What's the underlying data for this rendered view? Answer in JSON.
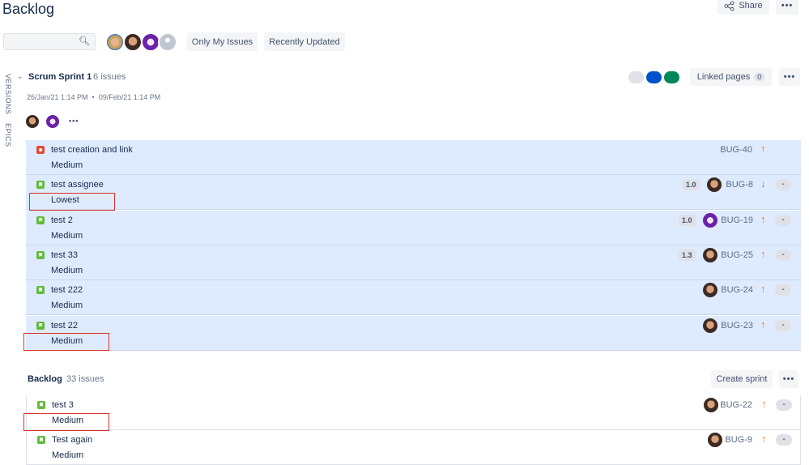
{
  "header": {
    "title": "Backlog",
    "share_label": "Share",
    "more_label": "•••"
  },
  "filters": {
    "search_placeholder": "",
    "only_my_issues": "Only My Issues",
    "recently_updated": "Recently Updated"
  },
  "side_tabs": {
    "versions": "VERSIONS",
    "epics": "EPICS"
  },
  "sprint": {
    "name": "Scrum Sprint 1",
    "count": "6 issues",
    "dates": "26/Jan/21 1:14 PM  •  09/Feb/21 1:14 PM",
    "linked_pages_label": "Linked pages",
    "linked_pages_count": "0",
    "more": "•••",
    "status_colors": [
      "#dfe1e6",
      "#0052cc",
      "#00875a"
    ],
    "issues": [
      {
        "type": "bug",
        "title": "test creation and link",
        "priority": "Medium",
        "key": "BUG-40",
        "estimate": "",
        "arrow": "up",
        "avatar": "",
        "status": ""
      },
      {
        "type": "story",
        "title": "test assignee",
        "priority": "Lowest",
        "key": "BUG-8",
        "estimate": "1.0",
        "arrow": "down",
        "avatar": "face",
        "status": "-"
      },
      {
        "type": "story",
        "title": "test 2",
        "priority": "Medium",
        "key": "BUG-19",
        "estimate": "1.0",
        "arrow": "up",
        "avatar": "ghost",
        "status": "-"
      },
      {
        "type": "story",
        "title": "test 33",
        "priority": "Medium",
        "key": "BUG-25",
        "estimate": "1.3",
        "arrow": "up",
        "avatar": "face",
        "status": "-"
      },
      {
        "type": "story",
        "title": "test 222",
        "priority": "Medium",
        "key": "BUG-24",
        "estimate": "",
        "arrow": "up",
        "avatar": "face",
        "status": "-"
      },
      {
        "type": "story",
        "title": "test 22",
        "priority": "Medium",
        "key": "BUG-23",
        "estimate": "",
        "arrow": "up",
        "avatar": "face",
        "status": "-"
      }
    ]
  },
  "backlog": {
    "name": "Backlog",
    "count": "33 issues",
    "create_sprint": "Create sprint",
    "more": "•••",
    "issues": [
      {
        "type": "story",
        "title": "test 3",
        "priority": "Medium",
        "key": "BUG-22",
        "estimate": "",
        "arrow": "up",
        "avatar": "face",
        "status": "-"
      },
      {
        "type": "story",
        "title": "Test again",
        "priority": "Medium",
        "key": "BUG-9",
        "estimate": "",
        "arrow": "up",
        "avatar": "face",
        "status": "-"
      }
    ]
  },
  "arrows": {
    "up": "↑",
    "down": "↓"
  }
}
